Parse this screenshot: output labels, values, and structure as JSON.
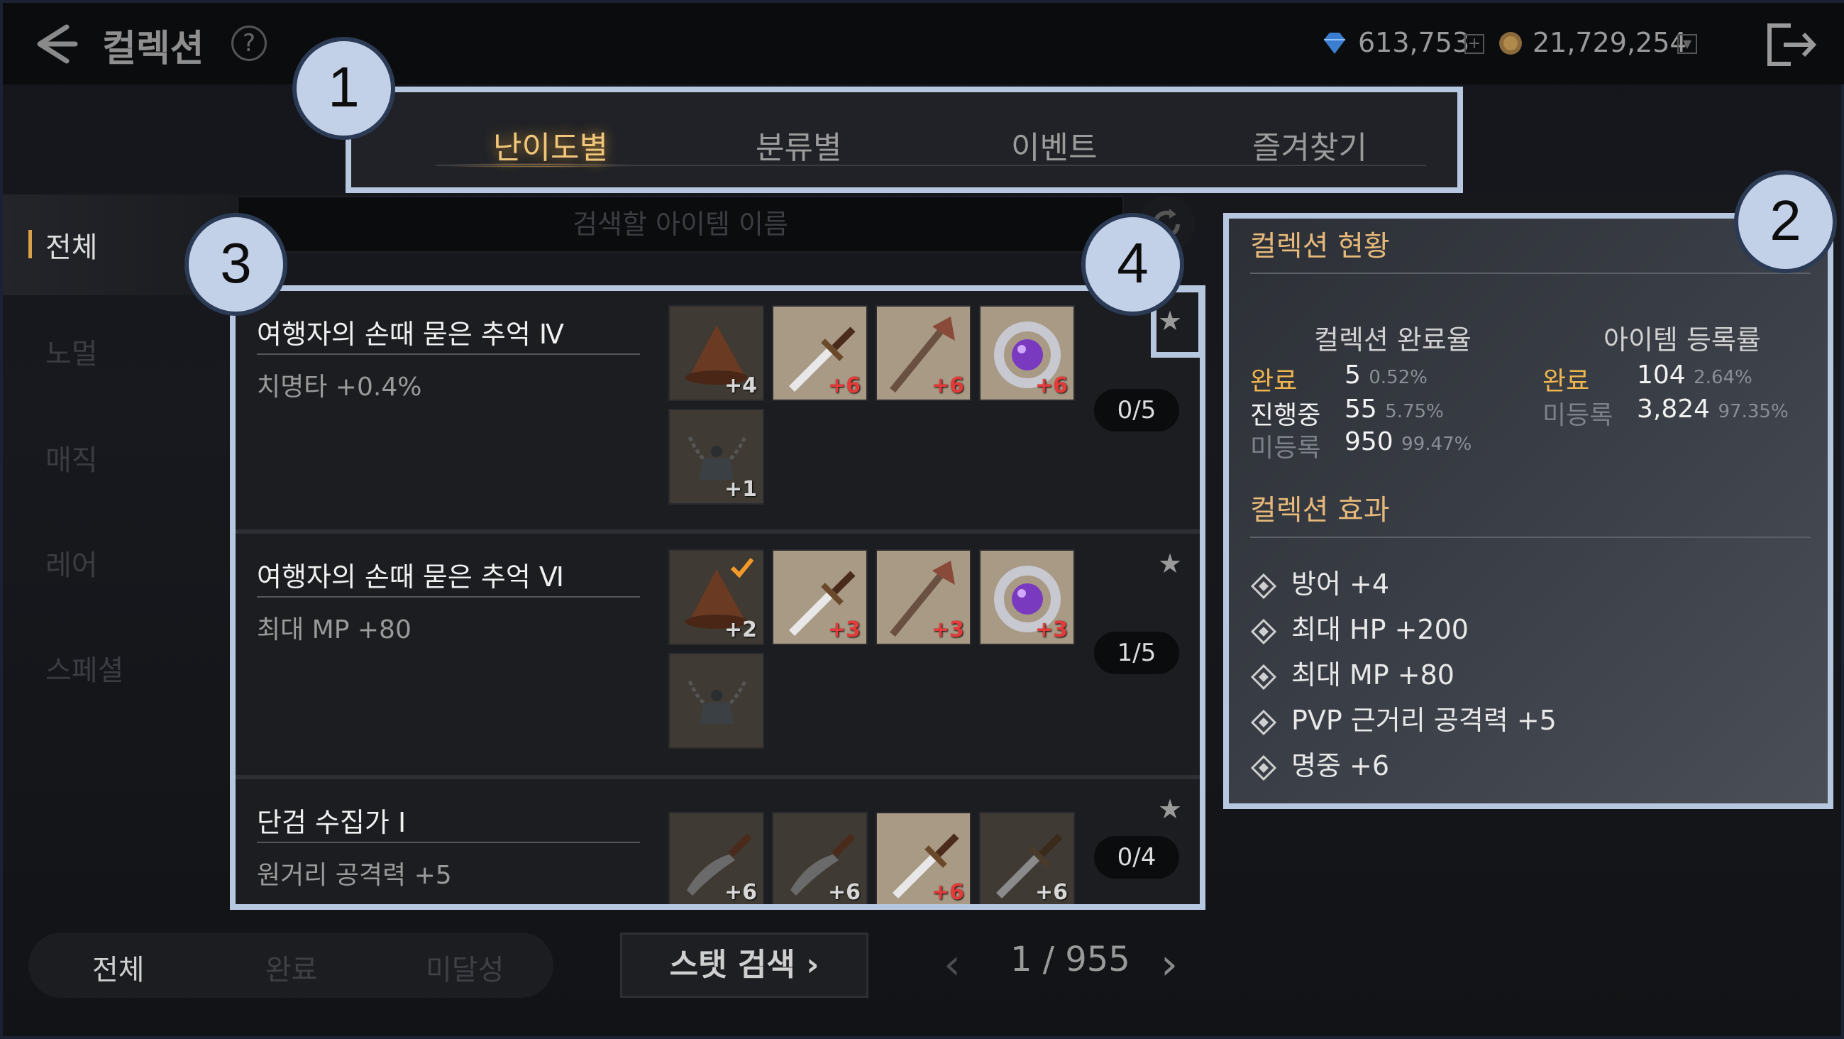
{
  "header": {
    "title": "컬렉션",
    "help": "?",
    "diamonds": "613,753",
    "gold": "21,729,254"
  },
  "tabs": [
    "난이도별",
    "분류별",
    "이벤트",
    "즐겨찾기"
  ],
  "sidebar": [
    "전체",
    "노멀",
    "매직",
    "레어",
    "스페셜"
  ],
  "search": {
    "placeholder": "검색할 아이템 이름"
  },
  "collections": [
    {
      "name": "여행자의 손때 묻은 추억 Ⅳ",
      "effect": "치명타 +0.4%",
      "count": "0/5",
      "items": [
        {
          "icon": "hat-icon",
          "level": "+4",
          "level_color": "grey",
          "owned": false
        },
        {
          "icon": "dagger-icon",
          "level": "+6",
          "level_color": "red",
          "owned": true
        },
        {
          "icon": "staff-icon",
          "level": "+6",
          "level_color": "red",
          "owned": true
        },
        {
          "icon": "ring-icon",
          "level": "+6",
          "level_color": "red",
          "owned": true
        },
        {
          "icon": "necklace-icon",
          "level": "+1",
          "level_color": "grey",
          "owned": false
        }
      ]
    },
    {
      "name": "여행자의 손때 묻은 추억 Ⅵ",
      "effect": "최대 MP +80",
      "count": "1/5",
      "items": [
        {
          "icon": "hat-icon",
          "level": "+2",
          "level_color": "grey",
          "owned": false,
          "checked": true
        },
        {
          "icon": "dagger-icon",
          "level": "+3",
          "level_color": "red",
          "owned": true
        },
        {
          "icon": "staff-icon",
          "level": "+3",
          "level_color": "red",
          "owned": true
        },
        {
          "icon": "ring-icon",
          "level": "+3",
          "level_color": "red",
          "owned": true
        },
        {
          "icon": "necklace-icon",
          "level": "",
          "level_color": "grey",
          "owned": false
        }
      ]
    },
    {
      "name": "단검 수집가 Ⅰ",
      "effect": "원거리 공격력 +5",
      "count": "0/4",
      "items": [
        {
          "icon": "curved-dagger-icon",
          "level": "+6",
          "level_color": "grey",
          "owned": false
        },
        {
          "icon": "curved-dagger-icon",
          "level": "+6",
          "level_color": "grey",
          "owned": false
        },
        {
          "icon": "dagger-icon",
          "level": "+6",
          "level_color": "red",
          "owned": true
        },
        {
          "icon": "dagger-icon",
          "level": "+6",
          "level_color": "grey",
          "owned": false
        }
      ]
    }
  ],
  "status": {
    "title": "컬렉션 현황",
    "completion_header": "컬렉션 완료율",
    "registration_header": "아이템 등록률",
    "completion": [
      {
        "label": "완료",
        "value": "5",
        "pct": "0.52%",
        "color": "gold"
      },
      {
        "label": "진행중",
        "value": "55",
        "pct": "5.75%",
        "color": "white"
      },
      {
        "label": "미등록",
        "value": "950",
        "pct": "99.47%",
        "color": "grey"
      }
    ],
    "registration": [
      {
        "label": "완료",
        "value": "104",
        "pct": "2.64%",
        "color": "gold"
      },
      {
        "label": "미등록",
        "value": "3,824",
        "pct": "97.35%",
        "color": "grey"
      }
    ],
    "effects_title": "컬렉션 효과",
    "effects": [
      "방어 +4",
      "최대 HP +200",
      "최대 MP +80",
      "PVP 근거리 공격력 +5",
      "명중 +6"
    ]
  },
  "footer": {
    "filters": [
      "전체",
      "완료",
      "미달성"
    ],
    "stat_search": "스탯 검색 ›",
    "page": "1 / 955"
  },
  "callouts": [
    "1",
    "2",
    "3",
    "4"
  ],
  "colors": {
    "accent": "#b8c7e0",
    "gold": "#f0b64e",
    "red": "#e53a3a"
  }
}
